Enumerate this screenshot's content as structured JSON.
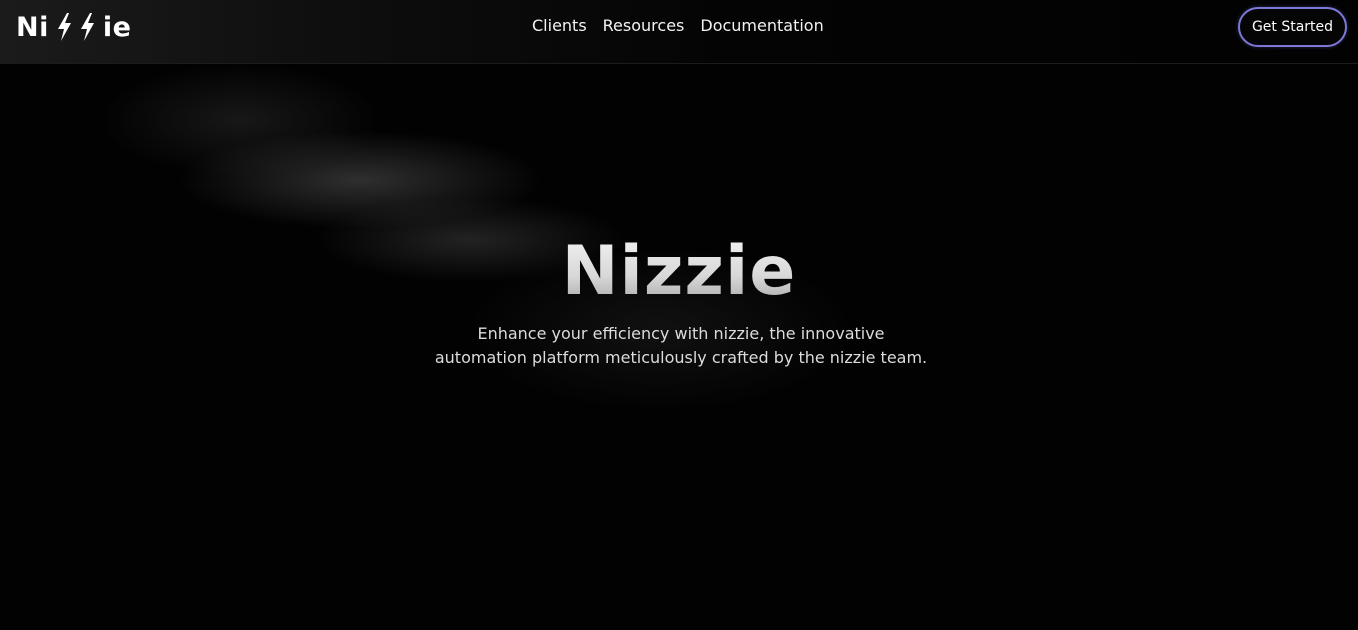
{
  "header": {
    "logo": {
      "text_start": "Ni",
      "text_end": "ie",
      "bolt_icon": "lightning-bolt-icon"
    },
    "nav": {
      "items": [
        {
          "label": "Clients"
        },
        {
          "label": "Resources"
        },
        {
          "label": "Documentation"
        }
      ]
    },
    "cta_label": "Get Started"
  },
  "hero": {
    "title": "Nizzie",
    "subtitle": "Enhance your efficiency with nizzie, the innovative automation platform meticulously crafted by the nizzie team."
  },
  "colors": {
    "background": "#020202",
    "accent_border": "#7b78d8",
    "text": "#ffffff"
  }
}
